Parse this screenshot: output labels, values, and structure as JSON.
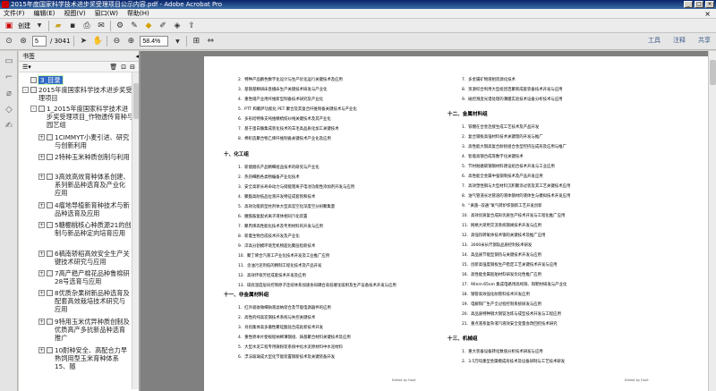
{
  "window": {
    "title": "2015年度国家科学技术进步奖受理项目公示内容.pdf - Adobe Acrobat Pro"
  },
  "menu": [
    "文件(F)",
    "编辑(E)",
    "视图(V)",
    "窗口(W)",
    "帮助(H)"
  ],
  "toolbar1": {
    "create_label": "创建"
  },
  "toolbar2": {
    "page_current": "5",
    "page_total": "/ 3041",
    "zoom": "58.4%",
    "tools": "工具",
    "comment": "注释",
    "share": "共享"
  },
  "panel": {
    "title": "书签"
  },
  "bookmarks": [
    {
      "label": "3_目录",
      "level": 1,
      "selected": true
    },
    {
      "label": "2015年度国家科学技术进步奖受理项目",
      "level": 1
    },
    {
      "label": "1_2015年度国家科学技术进步奖受理项目_作物遗传育种与园艺组",
      "level": 2
    },
    {
      "label": "1CIMMYT小麦引进、研究与创新利用",
      "level": 3
    },
    {
      "label": "2特种玉米种质创制与利用",
      "level": 3
    },
    {
      "label": "3高效高效育种体系创建、系列新品种选育及产业化应用",
      "level": 3
    },
    {
      "label": "4瘤地导植新育种技术与新品种选育及应用",
      "level": 3
    },
    {
      "label": "5糖棚桃核心种质源21的创制与新品种定向培育应用",
      "level": 3
    },
    {
      "label": "6稿南轿稻高效安全生产关键技术研究与应用",
      "level": 3
    },
    {
      "label": "7高产稳产棉花品种鲁棉研28号选育与应用",
      "level": 3
    },
    {
      "label": "8优质杂果树新品种选育及配套高效栽培技术研究与应用",
      "level": 3
    },
    {
      "label": "9特用玉米优异种质创制及优质高产多抗新品种选育推广",
      "level": 3
    },
    {
      "label": "10耐种安全、高配合力早熟饲用型玉米育种体系15、随",
      "level": 3
    }
  ],
  "page_left": {
    "lines": [
      "2．特种产品鹏色数字化设计与生产优化运行关键技术及应用",
      "3．基钢基精研床直播床生产关键技术研发与产业化",
      "4．重性储产业用纤维新型制备技术研究及产业化",
      "5．PTT 和聚萨功能化 PET 聚合及其复合纤维制备关键技术与产业化",
      "6．多形结特殊支纯维精梳纺纱线关键技术及其产业化",
      "7．基于蛋白酶集成装化技术的羊毛高品质化加工关键技术",
      "8．棉织造聚合物乙烯纤维制备关键技术产业化及应用"
    ],
    "h1": "十、化工组",
    "lines2": [
      "1．新烟烟农产品精细组品技术的研究与产业化",
      "2．热热细胞各类物编备产业化技术",
      "3．安全高新长寿命动力与储能锂离子电池功能性添加剂开发与应用",
      "4．聚酯高耐低品位液开发特征成套饱和技术",
      "5．高效功能新型柱剂体大型高炭空化深度空分树聚集量",
      "6．腰酰胺复配式离子液体相同汽化装置",
      "7．聚丙烯高性能化技术及专用材料的开发与应用",
      "8．新着生物合成技术开发及产业化",
      "9．淬高分割模环境无机物超化聚层指新技术",
      "10．聚丁烯合汽液工产业化技术开发及工业推广应用",
      "11．含油污泥剂低的精制工程化技术及产品开发",
      "12．高效环保芳烃成套技术开发及应用",
      "13．碳底温度层间控制原子连续体系加速协同耦合高低催化吸附及生产设备技术开发与应用"
    ],
    "h2": "十一、非金属材料组",
    "lines3": [
      "1．红外吸收微细钠液滤纳装合及节能电源器件的应用",
      "2．高性的纯高炭钢技术系统与失控关键技术",
      "3．肖焙集体高多循性聚硅酸盐合成处新技术开发",
      "4．重性原本片使规程纳稀薄钢组、铸基聚合材料关键技术及应用",
      "5．大型水泥工程专用微粉装系统中化水泥原材料中水泥材料",
      "6．浮法玻璃成大型化节能装置钢新技术及关键装备开发"
    ],
    "foot": "Edited by Foxit"
  },
  "page_right": {
    "lines": [
      "7．多金属矿物液相资源化技术",
      "8．资源综合利用大型组团百聚新成套装备技术开发与应用",
      "9．磁控溅变光谱处理的薄膜实验技术设备分析技术与应用"
    ],
    "h1": "十二、金属材料组",
    "lines2": [
      "1．铁糖在合金连接生成工艺技术及产品开发",
      "2．复合钢板高强材料技术关键理的开发与推广",
      "3．高性能大钢高复合耐损组合金型控挤压成形及应用与推广",
      "4．智能高钢合成等数字化关键技术",
      "5．节材耐磨碳钢钢材料建设组合技术开发与工业应用",
      "6．高性能全金属中强钢制技术及产品开发应用",
      "7．高效塑性钢与大型材料沉积聚涂过装及其工艺关键技术应用",
      "8．油气管道长达管道的液体钢材的液体生与模拟技术开发应用",
      "9．“黄菌--双通”氧气转炉炼钢新工艺开发创新",
      "10．高效优质复合成形优质生产技术开发与工程化推广应用",
      "11．网格大梁用交流系统钢阀技术开发与应用",
      "12．高强热转氧体技术钢的关键技术及推广应用",
      "13．3000米长尺钢轨品质控制技术研发",
      "14．高品质节能型钢热与关键技术开发与应用",
      "15．创新高强度钢板生产稳定工艺关键技术开发与应用",
      "16．高性能金属船舶材料研发优化性推广应用",
      "17．90nm-65nm 集成电路用高纯铜、铜靶材研发与产业化",
      "18．钢管高效强化耐管料技术开发应用",
      "19．电解铜厂生产全过程控制系统研发与应用",
      "20．高品质特种钢大钢锭冶炼与成型技术开发与工程应用",
      "21．重点液系复杂液汽液效安全变量会改回控技术研究"
    ],
    "h2": "十三、机械组",
    "lines3": [
      "1．重大装备设备转化数值分析技术研发与应用",
      "2．3.5万吨重型金属模成形技术及设备研制与工艺技术研发"
    ],
    "foot": "Edited by Foxit"
  }
}
